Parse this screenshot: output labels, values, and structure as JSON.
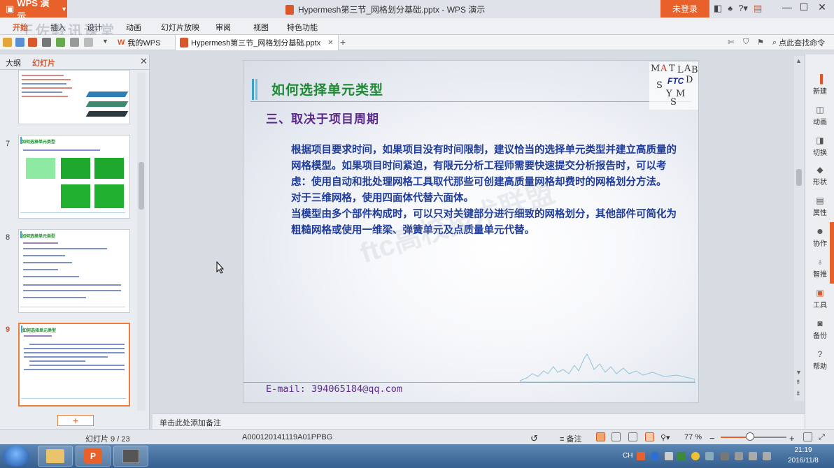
{
  "titlebar": {
    "app_label": "WPS 演示",
    "doc_title": "Hypermesh第三节_网格划分基础.pptx - WPS 演示",
    "login_label": "未登录"
  },
  "menu": {
    "items": [
      "开始",
      "插入",
      "设计",
      "动画",
      "幻灯片放映",
      "审阅",
      "视图",
      "特色功能"
    ],
    "watermark": "王佐教讯课堂"
  },
  "tabs": {
    "home_tab": "我的WPS",
    "doc_tab": "Hypermesh第三节_网格划分基础.pptx",
    "search_placeholder": "点此查找命令"
  },
  "left_panel": {
    "tab_outline": "大纲",
    "tab_slides": "幻灯片",
    "slide_numbers": [
      "7",
      "8",
      "9"
    ],
    "thumb_title": "如何选择单元类型",
    "add_slide_label": "+"
  },
  "slide": {
    "title": "如何选择单元类型",
    "subtitle": "三、取决于项目周期",
    "paragraphs": [
      "根据项目要求时间，如果项目没有时间限制，建议恰当的选择单元类型并建立高质量的网格模型。如果项目时间紧迫，有限元分析工程师需要快速提交分析报告时，可以考虑：使用自动和批处理网格工具取代那些可创建高质量网格却费时的网格划分方法。",
      "对于三维网格，使用四面体代替六面体。",
      "当模型由多个部件构成时，可以只对关键部分进行细致的网格划分，其他部件可简化为粗糙网格或使用一维梁、弹簧单元及点质量单元代替。"
    ],
    "email": "E-mail: 394065184@qq.com",
    "logo_letters": [
      "M",
      "A",
      "T",
      "L",
      "A",
      "B",
      "D",
      "S",
      "Y",
      "M",
      "S"
    ],
    "logo_center": "FTC",
    "watermark": "ftc高校技术联盟"
  },
  "right_panel": {
    "items": [
      "新建",
      "动画",
      "切换",
      "形状",
      "属性",
      "协作",
      "智推",
      "工具",
      "备份",
      "帮助"
    ]
  },
  "notes": {
    "placeholder": "单击此处添加备注"
  },
  "status": {
    "slide_indicator": "幻灯片 9 / 23",
    "template_id": "A000120141119A01PPBG",
    "notes_label": "备注",
    "zoom": "77 %",
    "zoom_fraction": 0.45
  },
  "taskbar": {
    "lang": "CH",
    "time": "21:19",
    "date": "2016/11/8"
  },
  "colors": {
    "accent": "#e8612a",
    "slide_title": "#1f8a35",
    "slide_subtitle": "#5c2a8a",
    "slide_body": "#1f3c9a"
  }
}
